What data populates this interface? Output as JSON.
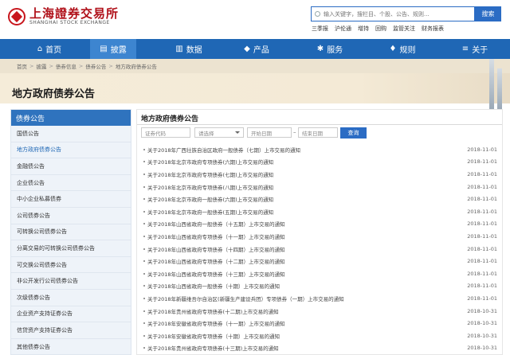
{
  "logo": {
    "cn": "上海證券交易所",
    "en": "SHANGHAI STOCK EXCHANGE"
  },
  "search": {
    "placeholder": "输入关键字，搜栏目、个股、公告、规则...",
    "button_label": "搜索"
  },
  "quick_links": [
    "三季报",
    "沪伦通",
    "增持",
    "回购",
    "监管关注",
    "财务报表"
  ],
  "nav": [
    {
      "label": "首页",
      "icon": "home-icon",
      "glyph": "⌂"
    },
    {
      "label": "披露",
      "icon": "disclosure-icon",
      "glyph": "▤"
    },
    {
      "label": "数据",
      "icon": "chart-icon",
      "glyph": "▥"
    },
    {
      "label": "产品",
      "icon": "product-icon",
      "glyph": "◆"
    },
    {
      "label": "服务",
      "icon": "service-icon",
      "glyph": "✱"
    },
    {
      "label": "规则",
      "icon": "rules-icon",
      "glyph": "♦"
    },
    {
      "label": "关于",
      "icon": "about-icon",
      "glyph": "≡"
    }
  ],
  "breadcrumb": [
    "首页",
    "披露",
    "债券信息",
    "债券公告",
    "地方政府债券公告"
  ],
  "page_title": "地方政府债券公告",
  "sidebar": {
    "title": "债券公告",
    "items": [
      "国债公告",
      "地方政府债券公告",
      "金融债公告",
      "企业债公告",
      "中小企业私募债券",
      "公司债券公告",
      "可转换公司债券公告",
      "分离交易的可转换公司债券公告",
      "可交换公司债券公告",
      "非公开发行公司债券公告",
      "次级债券公告",
      "企业资产支持证券公告",
      "信贷资产支持证券公告",
      "其他债券公告"
    ]
  },
  "main": {
    "title": "地方政府债券公告",
    "filters": {
      "code": "证券代码",
      "select": "请选择",
      "start": "开始日期",
      "end": "结束日期"
    },
    "query_label": "查询",
    "rows": [
      {
        "title": "关于2018年广西壮族自治区政府一般债券（七期）上市交易的通知",
        "date": "2018-11-01"
      },
      {
        "title": "关于2018年北京市政府专项债券(六期)上市交易的通知",
        "date": "2018-11-01"
      },
      {
        "title": "关于2018年北京市政府专项债券(七期)上市交易的通知",
        "date": "2018-11-01"
      },
      {
        "title": "关于2018年北京市政府专项债券(八期)上市交易的通知",
        "date": "2018-11-01"
      },
      {
        "title": "关于2018年北京市政府一般债券(六期)上市交易的通知",
        "date": "2018-11-01"
      },
      {
        "title": "关于2018年北京市政府一般债券(五期)上市交易的通知",
        "date": "2018-11-01"
      },
      {
        "title": "关于2018年山西省政府一般债券（十五期）上市交易的通知",
        "date": "2018-11-01"
      },
      {
        "title": "关于2018年山西省政府专项债券（十一期）上市交易的通知",
        "date": "2018-11-01"
      },
      {
        "title": "关于2018年山西省政府专项债券（十四期）上市交易的通知",
        "date": "2018-11-01"
      },
      {
        "title": "关于2018年山西省政府专项债券（十二期）上市交易的通知",
        "date": "2018-11-01"
      },
      {
        "title": "关于2018年山西省政府专项债券（十三期）上市交易的通知",
        "date": "2018-11-01"
      },
      {
        "title": "关于2018年山西省政府一般债券（十期）上市交易的通知",
        "date": "2018-11-01"
      },
      {
        "title": "关于2018年新疆维吾尔自治区(新疆生产建设兵团）专项债券（一期）上市交易的通知",
        "date": "2018-11-01"
      },
      {
        "title": "关于2018年贵州省政府专项债券(十二期)上市交易的通知",
        "date": "2018-10-31"
      },
      {
        "title": "关于2018年安徽省政府专项债券（十一期）上市交易的通知",
        "date": "2018-10-31"
      },
      {
        "title": "关于2018年安徽省政府专项债券（十期）上市交易的通知",
        "date": "2018-10-31"
      },
      {
        "title": "关于2018年贵州省政府专项债券(十三期)上市交易的通知",
        "date": "2018-10-31"
      }
    ]
  },
  "colors": {
    "nav_blue": "#1f67b5",
    "brand_red": "#c8161d",
    "button_blue": "#2b6cc4"
  }
}
